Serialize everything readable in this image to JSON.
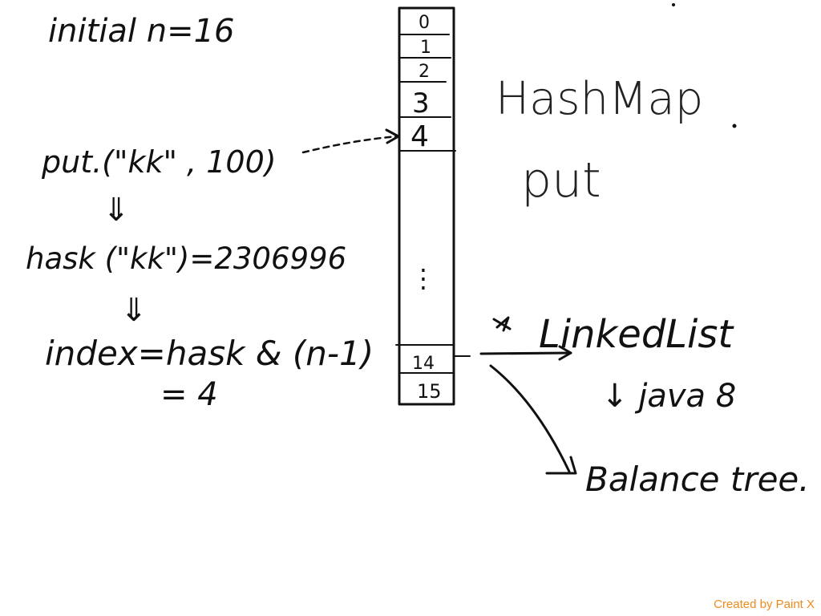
{
  "left_notes": {
    "initial": "initial  n=16",
    "put_call": "put.(\"kk\" , 100)",
    "implies_1": "⇓",
    "hash_call": "hask (\"kk\")=2306996",
    "implies_2": "⇓",
    "index_formula": "index=hask & (n-1)",
    "index_result": "= 4"
  },
  "table": {
    "slots_top": [
      "0",
      "1",
      "2",
      "3",
      "4"
    ],
    "ellipsis": "⋮",
    "slots_bottom": [
      "14",
      "15"
    ]
  },
  "right_notes": {
    "title_line_1": "HashMap",
    "title_line_2": "put",
    "linked_list": "LinkedList",
    "java_note": "↓ java 8",
    "balance_tree": "Balance tree."
  },
  "watermark": "Created by Paint X"
}
